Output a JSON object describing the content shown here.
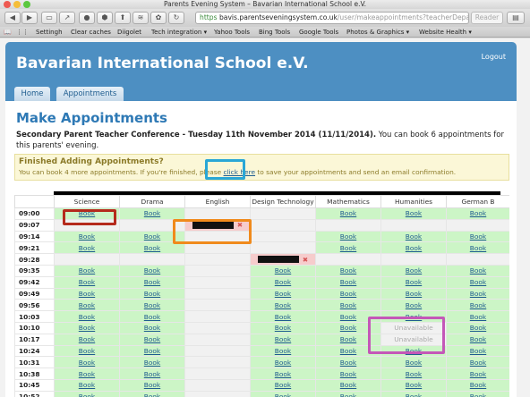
{
  "window": {
    "title": "Parents Evening System – Bavarian International School e.V."
  },
  "toolbar": {
    "url_scheme": "https",
    "url_host": "bavis.parentseveningsystem.co.uk",
    "url_path": "/user/makeappointments?teacherDepart",
    "reader_label": "Reader",
    "icons": [
      "back-icon",
      "forward-icon",
      "window-icon",
      "share-icon",
      "downloads-icon",
      "shield-icon",
      "upload-icon",
      "layers-icon",
      "gear-icon",
      "reload-icon",
      "add-tab-icon"
    ]
  },
  "bookmarks": [
    "Settingh",
    "Clear caches",
    "Diigolet",
    "Tech integration ▾",
    "Yahoo Tools",
    "Bing Tools",
    "Google Tools",
    "Photos & Graphics ▾",
    "Website Health ▾"
  ],
  "header": {
    "school": "Bavarian International School e.V.",
    "logout": "Logout"
  },
  "nav": {
    "home": "Home",
    "appointments": "Appointments"
  },
  "main": {
    "title": "Make Appointments",
    "conference": "Secondary Parent Teacher Conference - Tuesday 11th November 2014 (11/11/2014).",
    "conference_note": " You can book 6 appointments for this parents' evening."
  },
  "notice": {
    "title": "Finished Adding Appointments?",
    "text_before": "You can book 4 more appointments. If you're finished, please ",
    "link": "click here",
    "text_after": " to save your appointments and send an email confirmation."
  },
  "schedule": {
    "book_label": "Book",
    "unavailable_label": "Unavailable",
    "subjects": [
      "Science",
      "Drama",
      "English",
      "Design Technology",
      "Mathematics",
      "Humanities",
      "German B"
    ],
    "times": [
      "09:00",
      "09:07",
      "09:14",
      "09:21",
      "09:28",
      "09:35",
      "09:42",
      "09:49",
      "09:56",
      "10:03",
      "10:10",
      "10:17",
      "10:24",
      "10:31",
      "10:38",
      "10:45",
      "10:52"
    ],
    "rows": [
      [
        "B",
        "B",
        "-",
        "-",
        "B",
        "B",
        "B"
      ],
      [
        "-",
        "-",
        "X",
        "-",
        "-",
        "-",
        "-"
      ],
      [
        "B",
        "B",
        "-",
        "-",
        "B",
        "B",
        "B"
      ],
      [
        "B",
        "B",
        "-",
        "-",
        "B",
        "B",
        "B"
      ],
      [
        "-",
        "-",
        "-",
        "X",
        "-",
        "-",
        "-"
      ],
      [
        "B",
        "B",
        "-",
        "B",
        "B",
        "B",
        "B"
      ],
      [
        "B",
        "B",
        "-",
        "B",
        "B",
        "B",
        "B"
      ],
      [
        "B",
        "B",
        "-",
        "B",
        "B",
        "B",
        "B"
      ],
      [
        "B",
        "B",
        "-",
        "B",
        "B",
        "B",
        "B"
      ],
      [
        "B",
        "B",
        "-",
        "B",
        "B",
        "B",
        "B"
      ],
      [
        "B",
        "B",
        "-",
        "B",
        "B",
        "U",
        "B"
      ],
      [
        "B",
        "B",
        "-",
        "B",
        "B",
        "U",
        "B"
      ],
      [
        "B",
        "B",
        "-",
        "B",
        "B",
        "B",
        "B"
      ],
      [
        "B",
        "B",
        "-",
        "B",
        "B",
        "B",
        "B"
      ],
      [
        "B",
        "B",
        "-",
        "B",
        "B",
        "B",
        "B"
      ],
      [
        "B",
        "B",
        "-",
        "B",
        "B",
        "B",
        "B"
      ],
      [
        "B",
        "B",
        "-",
        "B",
        "B",
        "B",
        "B"
      ]
    ]
  },
  "colors": {
    "header_blue": "#4d8fc2",
    "title_blue": "#2e79b5",
    "book_green": "#ccf5c6",
    "booked_pink": "#f6cccc",
    "highlight_red": "#b52a1c",
    "highlight_orange": "#f08a1c",
    "highlight_cyan": "#2aa7d6",
    "highlight_magenta": "#c457b8"
  }
}
